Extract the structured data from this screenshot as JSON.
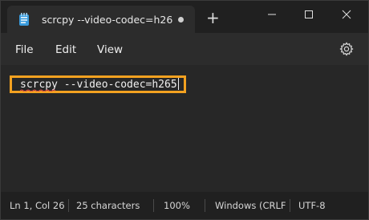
{
  "tab": {
    "title": "scrcpy --video-codec=h26",
    "icon": "notepad-icon",
    "new_tab_glyph": "+"
  },
  "window_controls": {
    "minimize_glyph": "—",
    "maximize_glyph": "□",
    "close_glyph": "✕"
  },
  "menu": {
    "file": "File",
    "edit": "Edit",
    "view": "View"
  },
  "settings": {
    "icon": "gear-icon"
  },
  "editor": {
    "content": "scrcpy --video-codec=h265",
    "highlight_color": "#f3a120"
  },
  "status": {
    "position": "Ln 1, Col 26",
    "characters": "25 characters",
    "zoom": "100%",
    "line_endings": "Windows (CRLF",
    "encoding": "UTF-8"
  }
}
